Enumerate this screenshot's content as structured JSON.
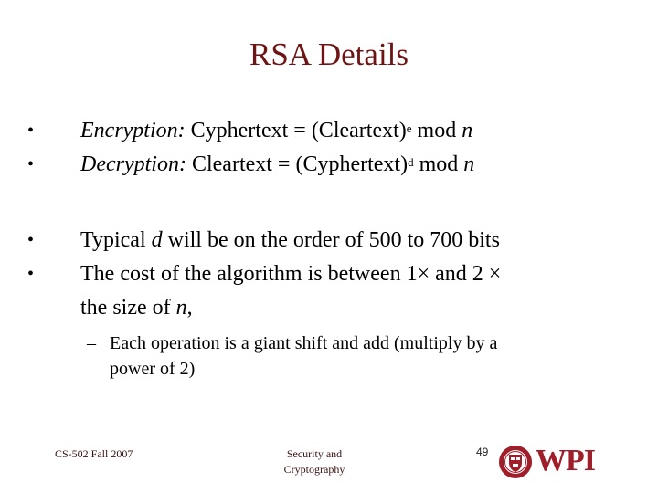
{
  "title": "RSA Details",
  "bullets": [
    {
      "marker": "•",
      "italic_label": "Encryption:",
      "text_before": " Cyphertext = (Cleartext)",
      "superscript": "e",
      "text_after": " mod ",
      "italic_var": "n"
    },
    {
      "marker": "•",
      "italic_label": "Decryption:",
      "text_before": " Cleartext = (Cyphertext)",
      "superscript": "d",
      "text_after": " mod ",
      "italic_var": "n"
    },
    {
      "marker": "•",
      "text_before": "Typical ",
      "italic_var": "d",
      "text_after": " will be on the order of 500 to 700 bits"
    },
    {
      "marker": "•",
      "line1": "The cost of the algorithm is between 1× and 2 ×",
      "line2_before": "the size of ",
      "line2_var": "n",
      "line2_after": ","
    }
  ],
  "sub_bullet": {
    "marker": "–",
    "line1": "Each operation is a giant shift and add (multiply by a",
    "line2": "power of 2)"
  },
  "footer": {
    "course": "CS-502 Fall 2007",
    "topic_line1": "Security and",
    "topic_line2": "Cryptography",
    "page_number": "49",
    "logo_text": "WPI"
  },
  "colors": {
    "title": "#6e1414",
    "logo": "#a01d2a"
  }
}
